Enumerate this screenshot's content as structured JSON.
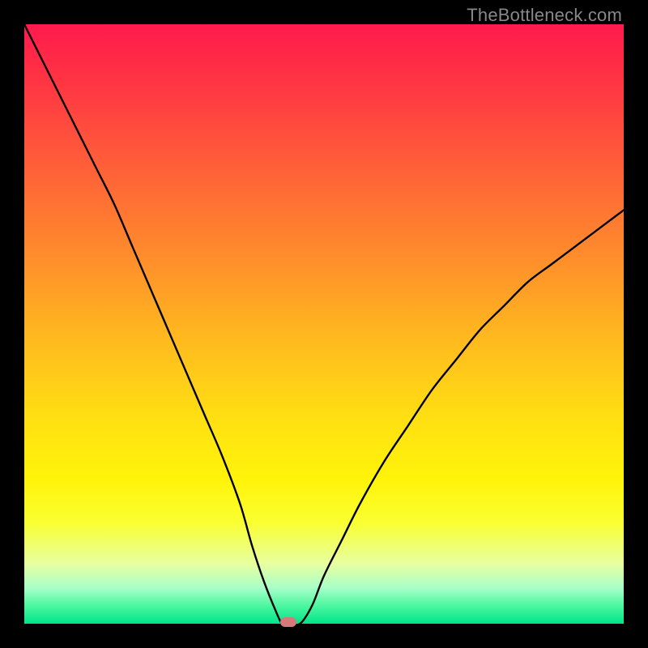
{
  "watermark": "TheBottleneck.com",
  "chart_data": {
    "type": "line",
    "title": "",
    "xlabel": "",
    "ylabel": "",
    "xlim": [
      0,
      100
    ],
    "ylim": [
      0,
      100
    ],
    "x": [
      0,
      3,
      6,
      9,
      12,
      15,
      18,
      21,
      24,
      27,
      30,
      33,
      36,
      38,
      40,
      42,
      43,
      44,
      46,
      48,
      50,
      53,
      56,
      60,
      64,
      68,
      72,
      76,
      80,
      84,
      88,
      92,
      96,
      100
    ],
    "y": [
      100,
      94,
      88,
      82,
      76,
      70,
      63,
      56,
      49,
      42,
      35,
      28,
      20,
      13,
      7,
      2,
      0,
      0,
      0,
      3,
      8,
      14,
      20,
      27,
      33,
      39,
      44,
      49,
      53,
      57,
      60,
      63,
      66,
      69
    ],
    "marker": {
      "x": 44,
      "y": 0
    },
    "background": "heat-gradient",
    "grid": false
  },
  "colors": {
    "stroke": "#000000",
    "marker": "#d47a7a"
  }
}
